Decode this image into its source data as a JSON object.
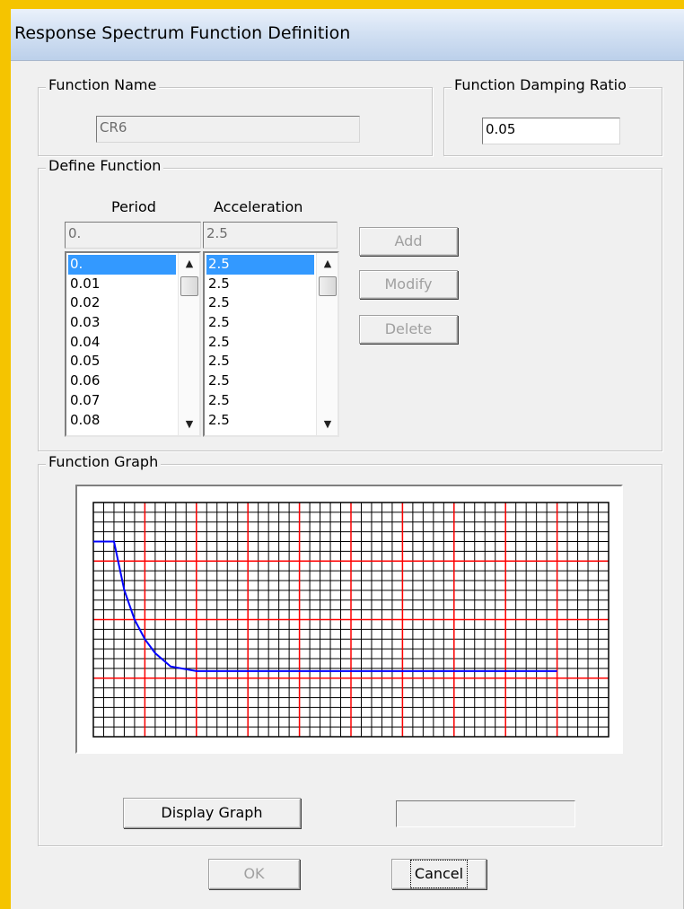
{
  "window": {
    "title": "Response Spectrum  Function Definition"
  },
  "function_name": {
    "group_label": "Function Name",
    "value": "CR6"
  },
  "damping_ratio": {
    "group_label": "Function Damping Ratio",
    "value": "0.05"
  },
  "define_function": {
    "group_label": "Define Function",
    "period_header": "Period",
    "acceleration_header": "Acceleration",
    "period_input": "0.",
    "acceleration_input": "2.5",
    "period_list": [
      "0.",
      "0.01",
      "0.02",
      "0.03",
      "0.04",
      "0.05",
      "0.06",
      "0.07",
      "0.08"
    ],
    "acceleration_list": [
      "2.5",
      "2.5",
      "2.5",
      "2.5",
      "2.5",
      "2.5",
      "2.5",
      "2.5",
      "2.5"
    ],
    "selected_index": 0,
    "add_label": "Add",
    "modify_label": "Modify",
    "delete_label": "Delete"
  },
  "function_graph": {
    "group_label": "Function Graph",
    "display_graph_label": "Display Graph",
    "status_text": ""
  },
  "footer": {
    "ok_label": "OK",
    "cancel_label": "Cancel"
  },
  "colors": {
    "frame_border": "#f5c400",
    "major_grid": "#ff0000",
    "minor_grid": "#000000",
    "curve": "#0000ff",
    "selection": "#3399ff"
  },
  "chart_data": {
    "type": "line",
    "x": [
      0,
      0.4,
      0.6,
      0.8,
      1.0,
      1.2,
      1.5,
      2.0,
      2.5,
      3.0,
      4.0,
      5.0,
      6.0,
      7.0,
      8.0,
      9.0
    ],
    "y": [
      2.5,
      2.5,
      1.88,
      1.5,
      1.25,
      1.07,
      0.9,
      0.84,
      0.84,
      0.84,
      0.84,
      0.84,
      0.84,
      0.84,
      0.84,
      0.84
    ],
    "xlim": [
      0,
      10
    ],
    "ylim": [
      0,
      3
    ],
    "grid": true,
    "title": "",
    "xlabel": "",
    "ylabel": ""
  }
}
